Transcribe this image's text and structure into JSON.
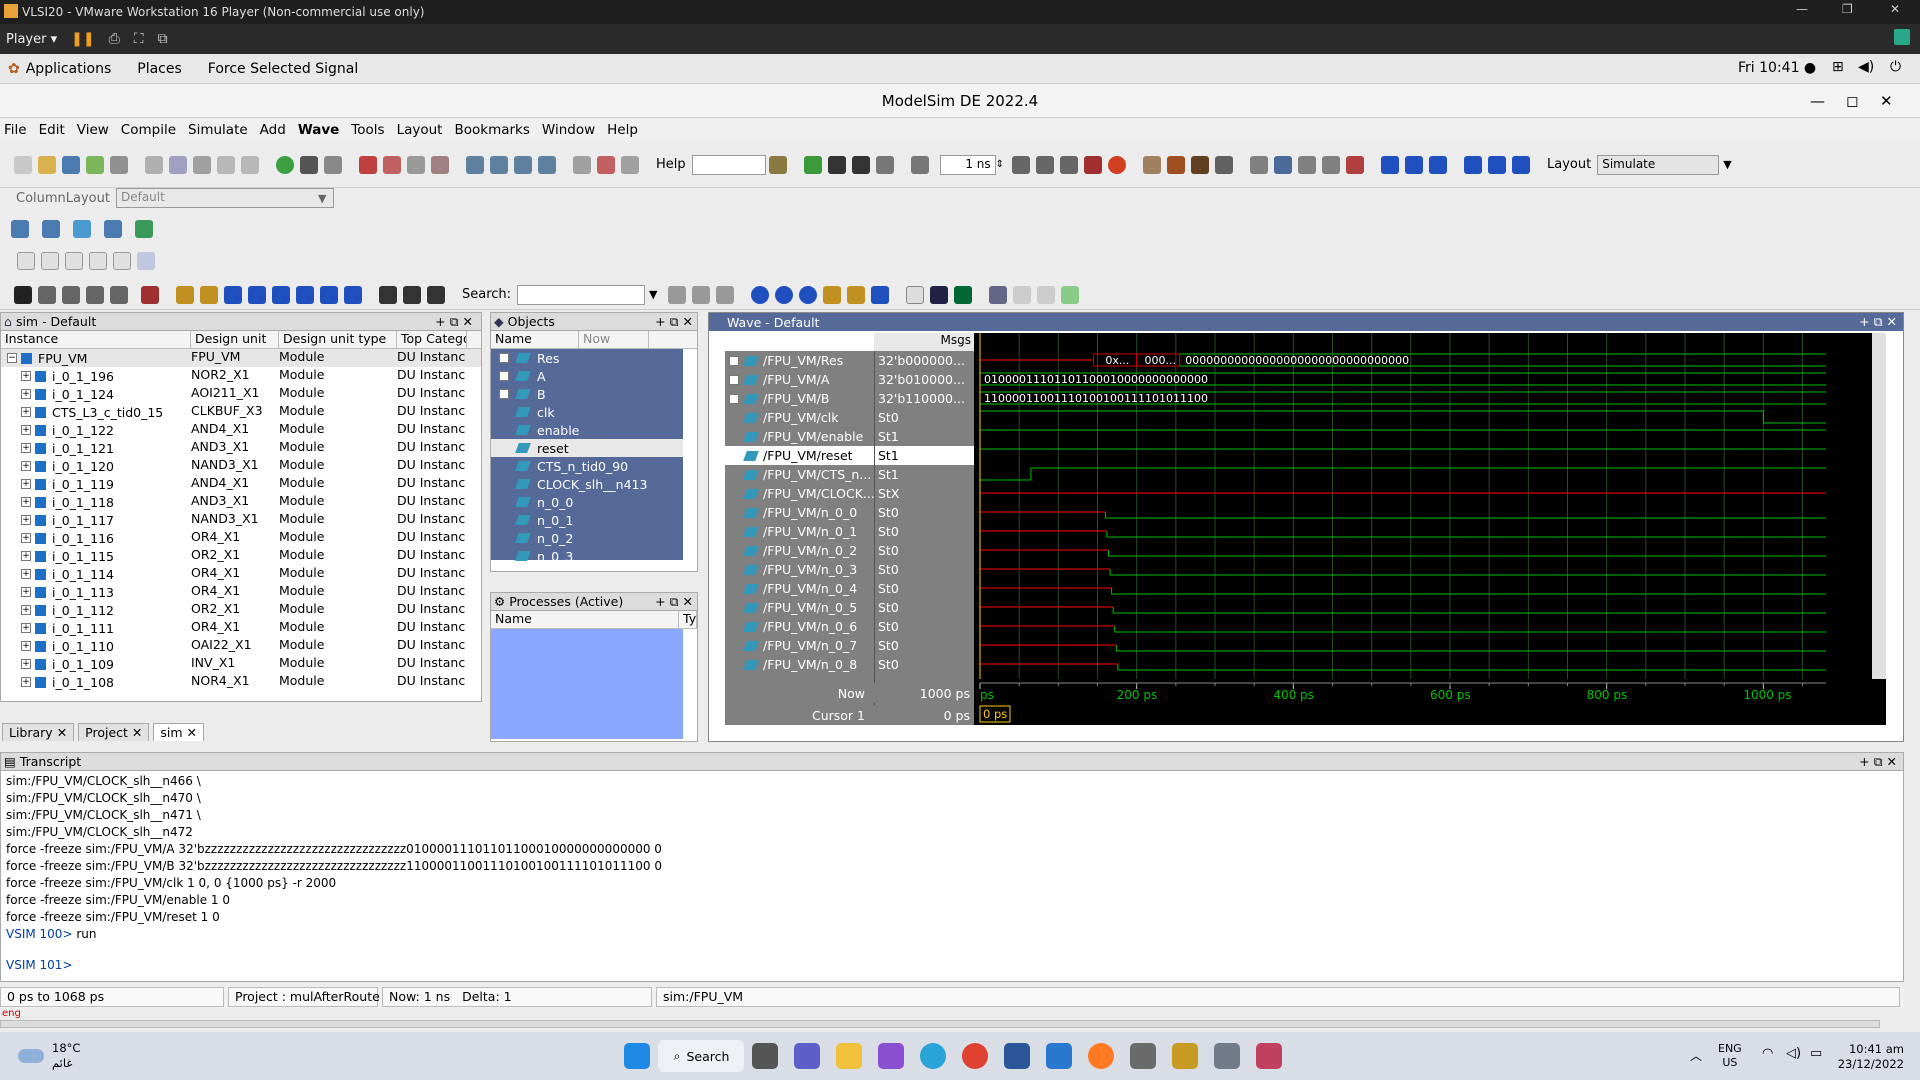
{
  "vmware": {
    "title": "VLSI20 - VMware Workstation 16 Player (Non-commercial use only)",
    "player_label": "Player ▾"
  },
  "gnome": {
    "applications": "Applications",
    "places": "Places",
    "force_menu": "Force Selected Signal",
    "clock": "Fri 10:41 ●"
  },
  "modelsim": {
    "title": "ModelSim DE 2022.4",
    "menus": [
      "File",
      "Edit",
      "View",
      "Compile",
      "Simulate",
      "Add",
      "Wave",
      "Tools",
      "Layout",
      "Bookmarks",
      "Window",
      "Help"
    ],
    "help_label": "Help",
    "time_step": "1 ns",
    "layout_label": "Layout",
    "layout_value": "Simulate",
    "column_layout_label": "ColumnLayout",
    "column_layout_value": "Default",
    "search_label": "Search:"
  },
  "sim_panel": {
    "title": "sim - Default",
    "columns": [
      "Instance",
      "Design unit",
      "Design unit type",
      "Top Catego"
    ],
    "rows": [
      {
        "instance": "FPU_VM",
        "unit": "FPU_VM",
        "type": "Module",
        "cat": "DU Instanc",
        "root": true
      },
      {
        "instance": "i_0_1_196",
        "unit": "NOR2_X1",
        "type": "Module",
        "cat": "DU Instanc"
      },
      {
        "instance": "i_0_1_124",
        "unit": "AOI211_X1",
        "type": "Module",
        "cat": "DU Instanc"
      },
      {
        "instance": "CTS_L3_c_tid0_15",
        "unit": "CLKBUF_X3",
        "type": "Module",
        "cat": "DU Instanc"
      },
      {
        "instance": "i_0_1_122",
        "unit": "AND4_X1",
        "type": "Module",
        "cat": "DU Instanc"
      },
      {
        "instance": "i_0_1_121",
        "unit": "AND3_X1",
        "type": "Module",
        "cat": "DU Instanc"
      },
      {
        "instance": "i_0_1_120",
        "unit": "NAND3_X1",
        "type": "Module",
        "cat": "DU Instanc"
      },
      {
        "instance": "i_0_1_119",
        "unit": "AND4_X1",
        "type": "Module",
        "cat": "DU Instanc"
      },
      {
        "instance": "i_0_1_118",
        "unit": "AND3_X1",
        "type": "Module",
        "cat": "DU Instanc"
      },
      {
        "instance": "i_0_1_117",
        "unit": "NAND3_X1",
        "type": "Module",
        "cat": "DU Instanc"
      },
      {
        "instance": "i_0_1_116",
        "unit": "OR4_X1",
        "type": "Module",
        "cat": "DU Instanc"
      },
      {
        "instance": "i_0_1_115",
        "unit": "OR2_X1",
        "type": "Module",
        "cat": "DU Instanc"
      },
      {
        "instance": "i_0_1_114",
        "unit": "OR4_X1",
        "type": "Module",
        "cat": "DU Instanc"
      },
      {
        "instance": "i_0_1_113",
        "unit": "OR4_X1",
        "type": "Module",
        "cat": "DU Instanc"
      },
      {
        "instance": "i_0_1_112",
        "unit": "OR2_X1",
        "type": "Module",
        "cat": "DU Instanc"
      },
      {
        "instance": "i_0_1_111",
        "unit": "OR4_X1",
        "type": "Module",
        "cat": "DU Instanc"
      },
      {
        "instance": "i_0_1_110",
        "unit": "OAI22_X1",
        "type": "Module",
        "cat": "DU Instanc"
      },
      {
        "instance": "i_0_1_109",
        "unit": "INV_X1",
        "type": "Module",
        "cat": "DU Instanc"
      },
      {
        "instance": "i_0_1_108",
        "unit": "NOR4_X1",
        "type": "Module",
        "cat": "DU Instanc"
      }
    ],
    "tabs": [
      "Library",
      "Project",
      "sim"
    ]
  },
  "objects_panel": {
    "title": "Objects",
    "col_name": "Name",
    "col_now": "Now",
    "items": [
      "Res",
      "A",
      "B",
      "clk",
      "enable",
      "reset",
      "CTS_n_tid0_90",
      "CLOCK_slh__n413",
      "n_0_0",
      "n_0_1",
      "n_0_2",
      "n_0_3"
    ]
  },
  "processes_panel": {
    "title": "Processes (Active)",
    "col_name": "Name",
    "col_type": "Ty"
  },
  "wave_panel": {
    "title": "Wave - Default",
    "msgs_label": "Msgs",
    "signals": [
      {
        "name": "/FPU_VM/Res",
        "value": "32'b000000...",
        "bus": true
      },
      {
        "name": "/FPU_VM/A",
        "value": "32'b010000...",
        "bus": true
      },
      {
        "name": "/FPU_VM/B",
        "value": "32'b110000...",
        "bus": true
      },
      {
        "name": "/FPU_VM/clk",
        "value": "St0"
      },
      {
        "name": "/FPU_VM/enable",
        "value": "St1"
      },
      {
        "name": "/FPU_VM/reset",
        "value": "St1",
        "selected": true
      },
      {
        "name": "/FPU_VM/CTS_n...",
        "value": "St1"
      },
      {
        "name": "/FPU_VM/CLOCK...",
        "value": "StX"
      },
      {
        "name": "/FPU_VM/n_0_0",
        "value": "St0"
      },
      {
        "name": "/FPU_VM/n_0_1",
        "value": "St0"
      },
      {
        "name": "/FPU_VM/n_0_2",
        "value": "St0"
      },
      {
        "name": "/FPU_VM/n_0_3",
        "value": "St0"
      },
      {
        "name": "/FPU_VM/n_0_4",
        "value": "St0"
      },
      {
        "name": "/FPU_VM/n_0_5",
        "value": "St0"
      },
      {
        "name": "/FPU_VM/n_0_6",
        "value": "St0"
      },
      {
        "name": "/FPU_VM/n_0_7",
        "value": "St0"
      },
      {
        "name": "/FPU_VM/n_0_8",
        "value": "St0"
      }
    ],
    "bus_text": {
      "res_a": "0x...",
      "res_b": "000...",
      "res_final": "00000000000000000000000000000000",
      "a": "01000011101101100010000000000000",
      "b": "11000011001110100100111101011100"
    },
    "now_label": "Now",
    "now_value": "1000 ps",
    "cursor_label": "Cursor 1",
    "cursor_value": "0 ps",
    "cursor_marker": "0 ps",
    "time_ticks": [
      "ps",
      "200 ps",
      "400 ps",
      "600 ps",
      "800 ps",
      "1000 ps"
    ],
    "colors": {
      "bg": "#000000",
      "green": "#00c000",
      "red": "#d00000",
      "grid": "#2a4a2a"
    }
  },
  "transcript": {
    "title": "Transcript",
    "lines": [
      "sim:/FPU_VM/CLOCK_slh__n466 \\",
      "sim:/FPU_VM/CLOCK_slh__n470 \\",
      "sim:/FPU_VM/CLOCK_slh__n471 \\",
      "sim:/FPU_VM/CLOCK_slh__n472",
      "force -freeze sim:/FPU_VM/A 32'bzzzzzzzzzzzzzzzzzzzzzzzzzzzzzzzz01000011101101100010000000000000 0",
      "force -freeze sim:/FPU_VM/B 32'bzzzzzzzzzzzzzzzzzzzzzzzzzzzzzzzz11000011001110100100111101011100 0",
      "force -freeze sim:/FPU_VM/clk 1 0, 0 {1000 ps} -r 2000",
      "force -freeze sim:/FPU_VM/enable 1 0",
      "force -freeze sim:/FPU_VM/reset 1 0"
    ],
    "prompt1": "VSIM 100>",
    "cmd1": "run",
    "prompt2": "VSIM 101>"
  },
  "status": {
    "range": "0 ps to 1068 ps",
    "project": "Project : mulAfterRoute",
    "now": "Now: 1 ns",
    "delta": "Delta: 1",
    "context": "sim:/FPU_VM",
    "partial": "eng"
  },
  "taskbar": {
    "weather_temp": "18°C",
    "weather_desc": "غائم",
    "search": "Search",
    "lang": "ENG",
    "region": "US",
    "time": "10:41 am",
    "date": "23/12/2022"
  }
}
